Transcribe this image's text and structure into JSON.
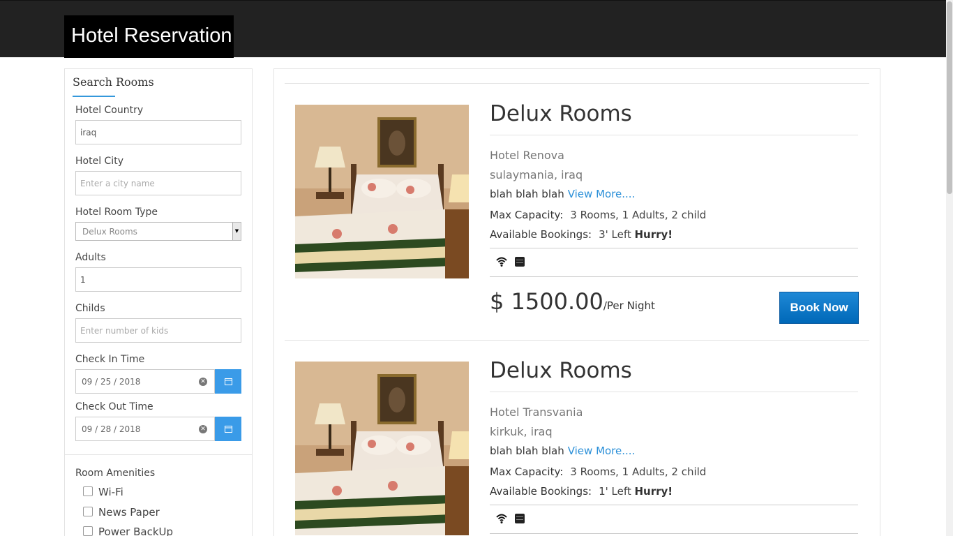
{
  "header": {
    "brand": "Hotel Reservation"
  },
  "search": {
    "title": "Search Rooms",
    "country_label": "Hotel Country",
    "country_value": "iraq",
    "city_label": "Hotel City",
    "city_placeholder": "Enter a city name",
    "room_type_label": "Hotel Room Type",
    "room_type_value": "Delux Rooms",
    "adults_label": "Adults",
    "adults_value": "1",
    "childs_label": "Childs",
    "childs_placeholder": "Enter number of kids",
    "checkin_label": "Check In Time",
    "checkin_value": "09 / 25 / 2018",
    "checkout_label": "Check Out Time",
    "checkout_value": "09 / 28 / 2018",
    "amenities_title": "Room Amenities",
    "amenities": [
      "Wi-Fi",
      "News Paper",
      "Power BackUp"
    ]
  },
  "rooms": [
    {
      "title": "Delux Rooms",
      "hotel": "Hotel Renova",
      "location": "sulaymania, iraq",
      "description": "blah blah blah",
      "view_more": "View More....",
      "capacity_label": "Max Capacity:",
      "capacity_value": "3 Rooms, 1 Adults, 2 child",
      "bookings_label": "Available Bookings:",
      "bookings_value": "3' Left",
      "hurry": "Hurry!",
      "price": "$ 1500.00",
      "per_night": "/Per Night",
      "book_label": "Book Now"
    },
    {
      "title": "Delux Rooms",
      "hotel": "Hotel Transvania",
      "location": "kirkuk, iraq",
      "description": "blah blah blah",
      "view_more": "View More....",
      "capacity_label": "Max Capacity:",
      "capacity_value": "3 Rooms, 1 Adults, 2 child",
      "bookings_label": "Available Bookings:",
      "bookings_value": "1' Left",
      "hurry": "Hurry!"
    }
  ],
  "icons": {
    "wifi": "wifi-icon",
    "newspaper": "newspaper-icon",
    "calendar": "calendar-icon",
    "clear": "clear-icon"
  },
  "colors": {
    "accent": "#3498db",
    "book_button": "#0a75c9",
    "link": "#2a8fd8",
    "header_bg": "#222222"
  }
}
